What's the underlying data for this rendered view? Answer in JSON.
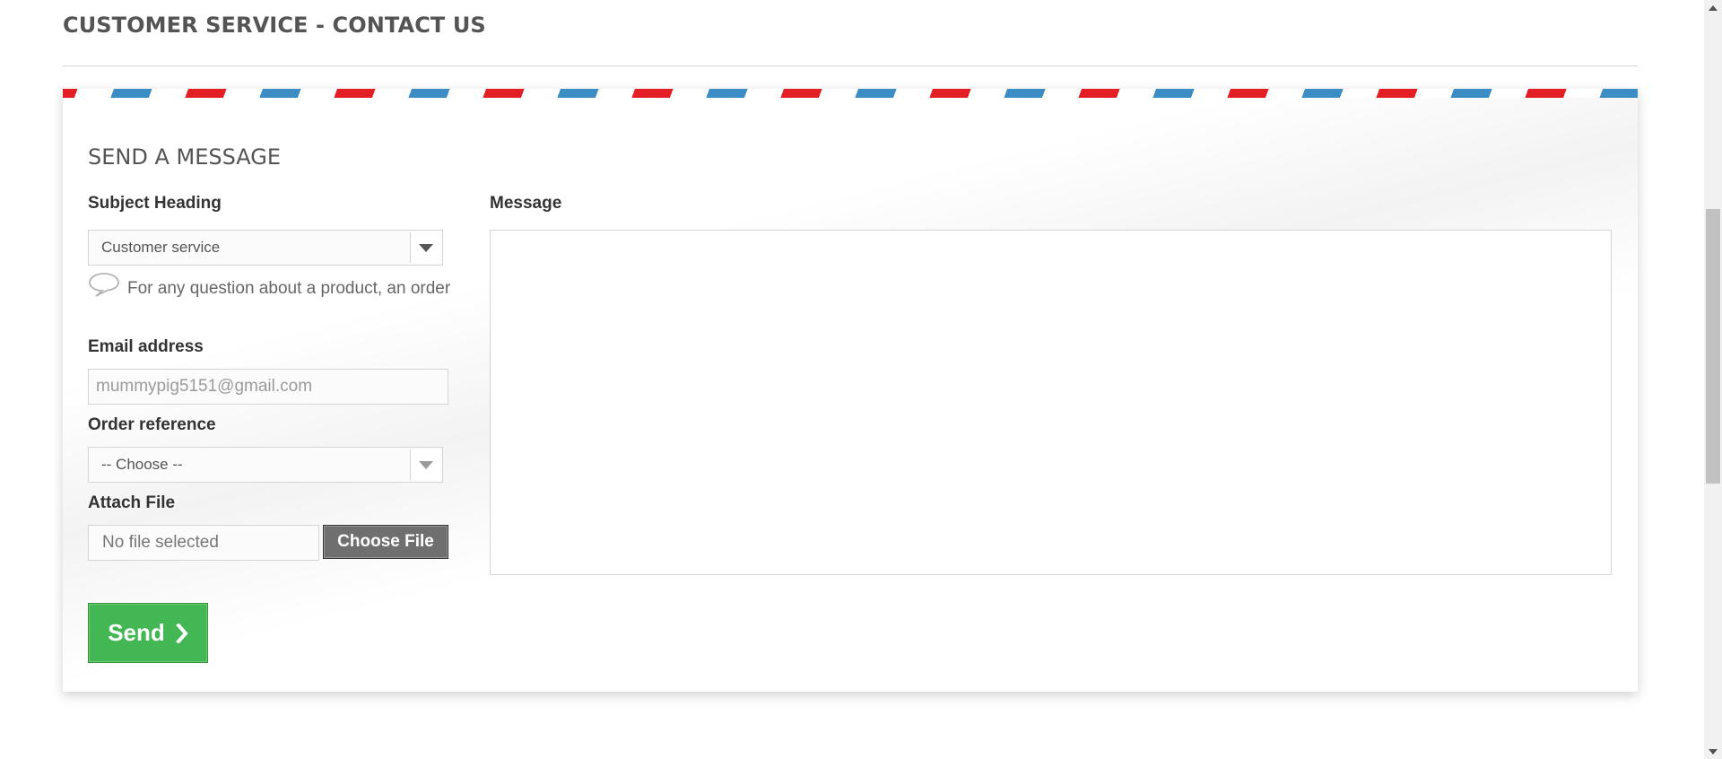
{
  "page": {
    "title": "CUSTOMER SERVICE - CONTACT US"
  },
  "form": {
    "title": "SEND A MESSAGE",
    "subject": {
      "label": "Subject Heading",
      "selected": "Customer service",
      "hint": "For any question about a product, an order"
    },
    "email": {
      "label": "Email address",
      "placeholder": "mummypig5151@gmail.com"
    },
    "order_reference": {
      "label": "Order reference",
      "selected": "-- Choose --"
    },
    "attach": {
      "label": "Attach File",
      "file_status": "No file selected",
      "button_label": "Choose File"
    },
    "message": {
      "label": "Message",
      "value": ""
    },
    "send_label": "Send"
  },
  "colors": {
    "airmail_blue": "#3b8dc4",
    "airmail_red": "#e31e24",
    "send_green": "#43b754",
    "heading_text": "#555454"
  },
  "icons": {
    "hint": "speech-bubble-icon",
    "send": "chevron-right-icon",
    "select": "caret-down-icon"
  }
}
